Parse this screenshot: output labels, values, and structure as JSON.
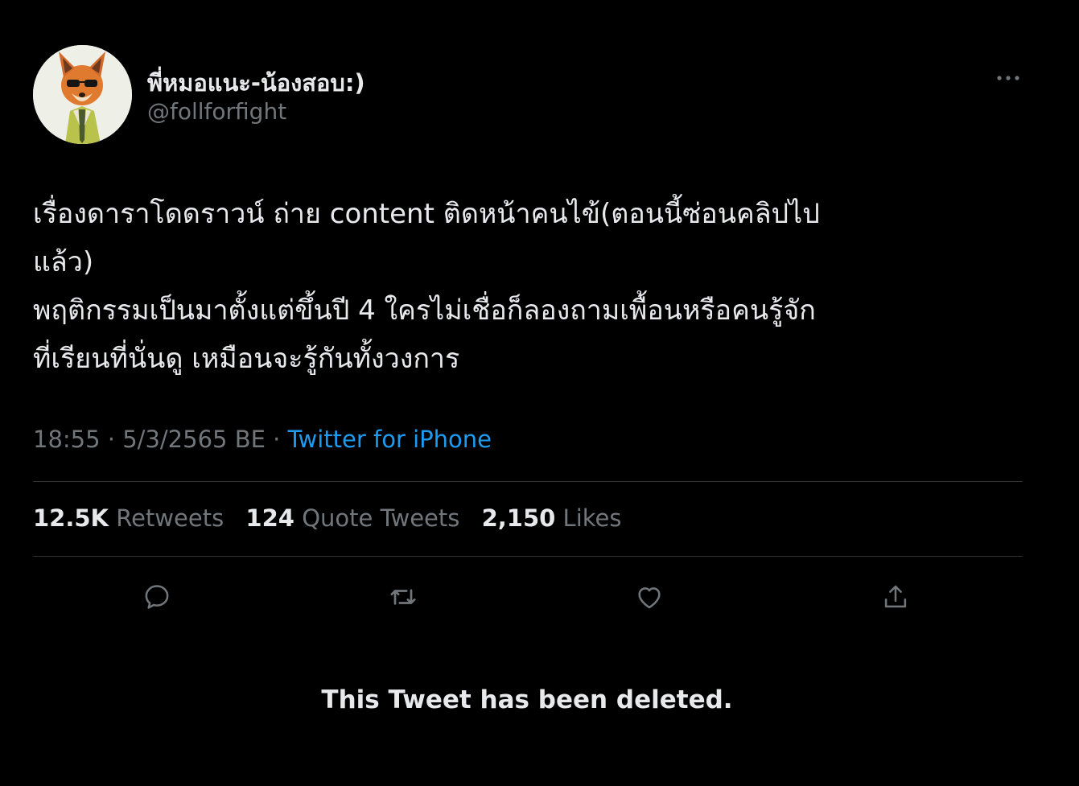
{
  "author": {
    "display_name": "พี่หมอแนะ-น้องสอบ:)",
    "handle": "@follforfight"
  },
  "tweet": {
    "lines": [
      "เรื่องดาราโดดราวน์ ถ่าย content ติดหน้าคนไข้(ตอนนี้ซ่อนคลิปไป",
      "แล้ว)",
      "พฤติกรรมเป็นมาตั้งแต่ขึ้นปี 4  ใครไม่เชื่อก็ลองถามเพื้อนหรือคนรู้จัก",
      "ที่เรียนที่นั่นดู เหมือนจะรู้กันทั้งวงการ"
    ],
    "time": "18:55",
    "date": "5/3/2565 BE",
    "separator": "·",
    "source": "Twitter for iPhone"
  },
  "stats": {
    "retweets_count": "12.5K",
    "retweets_label": "Retweets",
    "quotes_count": "124",
    "quotes_label": "Quote Tweets",
    "likes_count": "2,150",
    "likes_label": "Likes"
  },
  "deleted_notice": "This Tweet has been deleted.",
  "icons": {
    "more": "more-horizontal-icon",
    "reply": "reply-icon",
    "retweet": "retweet-icon",
    "like": "heart-icon",
    "share": "share-icon"
  },
  "colors": {
    "background": "#000000",
    "text": "#e7e9ea",
    "muted": "#71767b",
    "link": "#1d9bf0",
    "divider": "#2f3336"
  }
}
